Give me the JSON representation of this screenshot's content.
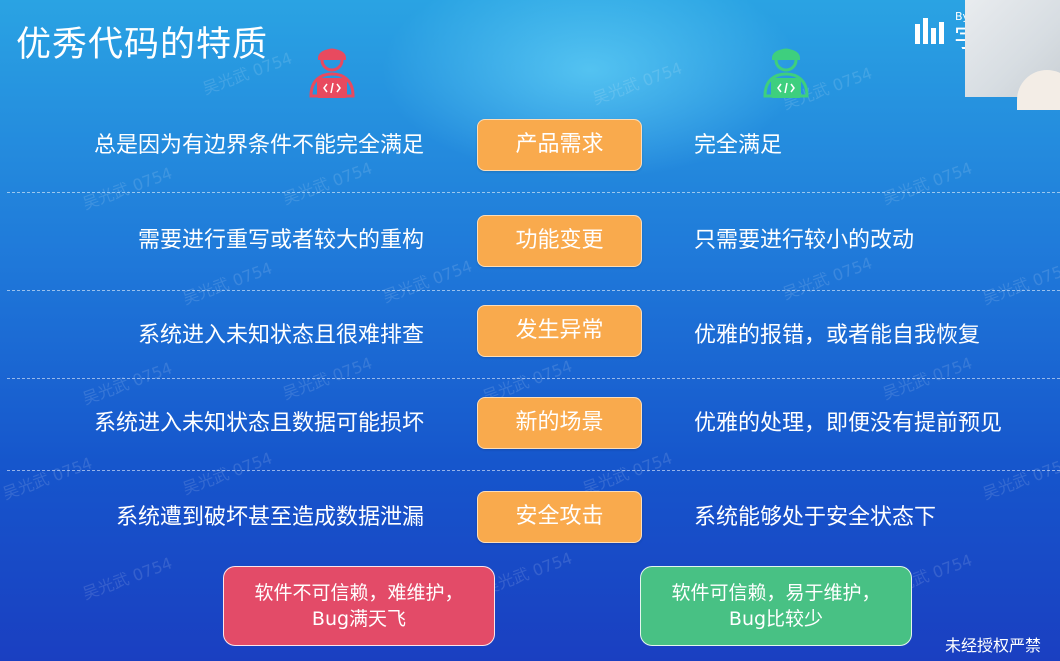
{
  "slide": {
    "title": "优秀代码的特质",
    "footer": "未经授权严禁",
    "watermark": "吴光武 0754",
    "brand_text": "By",
    "brand_char": "字"
  },
  "avatars": {
    "left": {
      "icon": "developer-laptop-icon",
      "color": "#e84a5f"
    },
    "right": {
      "icon": "developer-laptop-icon",
      "color": "#3ecf7e"
    }
  },
  "rows": [
    {
      "left": "总是因为有边界条件不能完全满足",
      "pill": "产品需求",
      "right": "完全满足"
    },
    {
      "left": "需要进行重写或者较大的重构",
      "pill": "功能变更",
      "right": "只需要进行较小的改动"
    },
    {
      "left": "系统进入未知状态且很难排查",
      "pill": "发生异常",
      "right": "优雅的报错，或者能自我恢复"
    },
    {
      "left": "系统进入未知状态且数据可能损坏",
      "pill": "新的场景",
      "right": "优雅的处理，即便没有提前预见"
    },
    {
      "left": "系统遭到破坏甚至造成数据泄漏",
      "pill": "安全攻击",
      "right": "系统能够处于安全状态下"
    }
  ],
  "verdicts": {
    "bad": {
      "line1": "软件不可信赖，难维护，",
      "line2": "Bug满天飞",
      "color": "#e34b68"
    },
    "good": {
      "line1": "软件可信赖，易于维护，",
      "line2": "Bug比较少",
      "color": "#48c184"
    }
  },
  "colors": {
    "pill": "#f9aa4d",
    "background_top": "#2aa3e3",
    "background_bottom": "#1a3fc1"
  }
}
